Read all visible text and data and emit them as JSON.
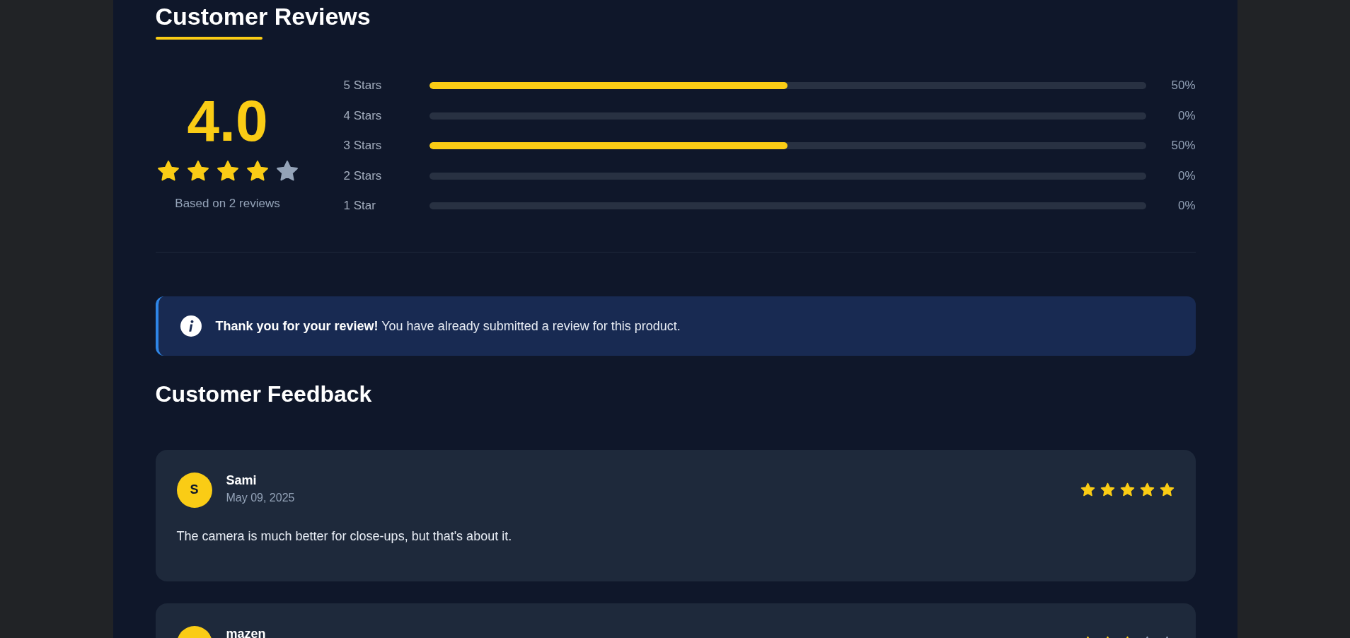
{
  "title": {
    "text": "Customer Reviews"
  },
  "summary": {
    "average": "4.0",
    "stars": 4,
    "caption": "Based on 2 reviews"
  },
  "distribution": [
    {
      "label": "5 Stars",
      "level": 0.5,
      "percent": "50%"
    },
    {
      "label": "4 Stars",
      "level": 0,
      "percent": "0%"
    },
    {
      "label": "3 Stars",
      "level": 0.5,
      "percent": "50%"
    },
    {
      "label": "2 Stars",
      "level": 0,
      "percent": "0%"
    },
    {
      "label": "1 Star",
      "level": 0,
      "percent": "0%"
    }
  ],
  "notice": {
    "kind": "info",
    "text": "**Thank you for your review!** You have already submitted a review for this product."
  },
  "feedback": {
    "title": "Customer Feedback"
  },
  "reviews": [
    {
      "initial": "S",
      "name": "Sami",
      "date": "May 09, 2025",
      "stars": 5,
      "text": "The camera is much better for close-ups, but that's about it."
    },
    {
      "name": "mazen",
      "stars": 3
    }
  ]
}
